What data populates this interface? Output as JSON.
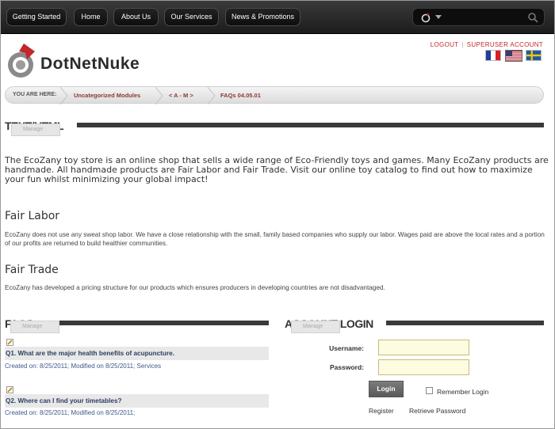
{
  "nav": {
    "items": [
      "Getting Started",
      "Home",
      "About Us",
      "Our Services",
      "News & Promotions"
    ]
  },
  "header": {
    "logo_text": "DotNetNuke",
    "logout": "LOGOUT",
    "account": "SUPERUSER ACCOUNT",
    "flags": [
      "fr-FR",
      "en-US",
      "sv-SE"
    ]
  },
  "breadcrumb": {
    "label": "YOU ARE HERE:",
    "items": [
      "Uncategorized Modules",
      "< A - M >",
      "FAQs 04.05.01"
    ]
  },
  "text_html": {
    "title": "TEXT/HTML",
    "manage": "Manage",
    "intro": "The EcoZany toy store is an online shop that sells a wide range of Eco-Friendly toys and games.  Many EcoZany products are handmade. All handmade products are Fair Labor and Fair Trade. Visit our online toy catalog to find out how to maximize your fun whilst minimizing your global impact!",
    "fair_labor_title": "Fair Labor",
    "fair_labor_text": "EcoZany does not use any sweat shop labor. We have a close relationship with the small, family based companies who supply our labor. Wages paid are above the local rates and a portion of our profits are returned to build healthier communities.",
    "fair_trade_title": "Fair Trade",
    "fair_trade_text": "EcoZany has developed a pricing structure for our products which ensures producers in developing countries are not disadvantaged."
  },
  "faqs": {
    "title": "FAQS",
    "manage": "Manage",
    "items": [
      {
        "question": "Q1. What are the major health benefits of acupuncture.",
        "meta": "Created on: 8/25/2011; Modified on 8/25/2011; Services"
      },
      {
        "question": "Q2. Where can I find your timetables?",
        "meta": "Created on: 8/25/2011; Modified on 8/25/2011;"
      }
    ]
  },
  "login": {
    "title": "ACCOUNT LOGIN",
    "manage": "Manage",
    "username_label": "Username:",
    "password_label": "Password:",
    "username_value": "",
    "password_value": "",
    "login_button": "Login",
    "remember": "Remember Login",
    "register": "Register",
    "retrieve": "Retrieve Password"
  },
  "colors": {
    "accent_red": "#c1272d",
    "nav_bg": "#1c1c1c",
    "faq_link": "#2c3e60"
  }
}
